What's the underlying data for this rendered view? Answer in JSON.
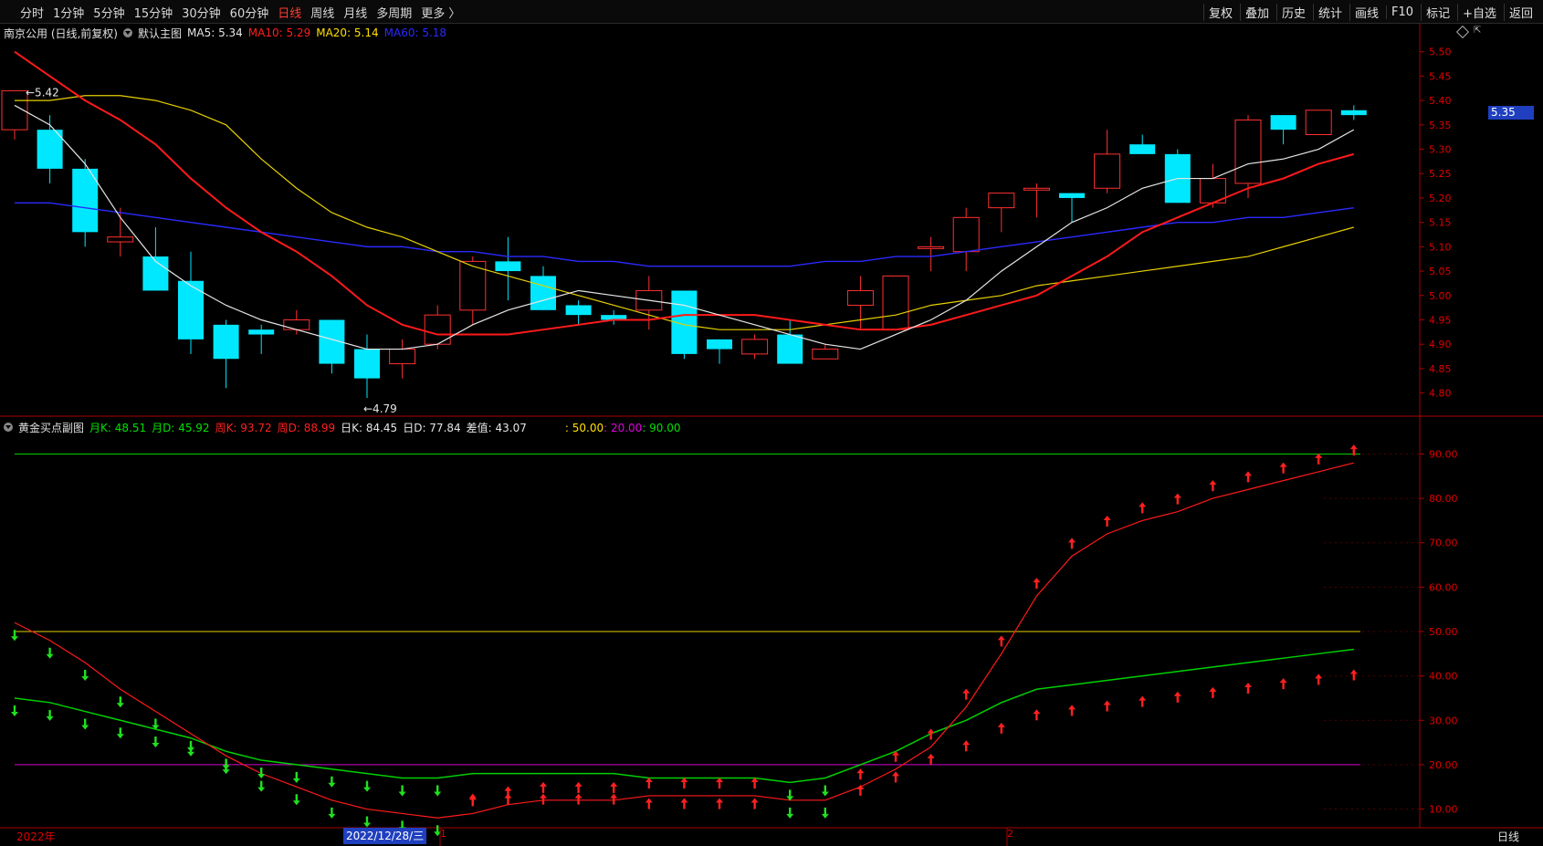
{
  "toolbar": {
    "periods": [
      "分时",
      "1分钟",
      "5分钟",
      "15分钟",
      "30分钟",
      "60分钟",
      "日线",
      "周线",
      "月线",
      "多周期",
      "更多 〉"
    ],
    "active_period": "日线",
    "tools": [
      "复权",
      "叠加",
      "历史",
      "统计",
      "画线",
      "F10",
      "标记",
      "+自选",
      "返回"
    ]
  },
  "main_chart": {
    "title": "南京公用 (日线,前复权)",
    "template": "默认主图",
    "ma": [
      {
        "label": "MA5: 5.34",
        "color": "#e6e6e6"
      },
      {
        "label": "MA10: 5.29",
        "color": "#ff2020"
      },
      {
        "label": "MA20: 5.14",
        "color": "#ffe000"
      },
      {
        "label": "MA60: 5.18",
        "color": "#2a2aff"
      }
    ],
    "current_price": "5.35",
    "high_label": "5.42",
    "low_label": "4.79",
    "y_ticks": [
      "5.50",
      "5.45",
      "5.40",
      "5.35",
      "5.30",
      "5.25",
      "5.20",
      "5.15",
      "5.10",
      "5.05",
      "5.00",
      "4.95",
      "4.90",
      "4.85",
      "4.80"
    ]
  },
  "sub_chart": {
    "title": "黄金买点副图",
    "values": [
      {
        "label": "月K: 48.51",
        "color": "#00e000"
      },
      {
        "label": "月D: 45.92",
        "color": "#00e000"
      },
      {
        "label": "周K: 93.72",
        "color": "#ff2020"
      },
      {
        "label": "周D: 88.99",
        "color": "#ff2020"
      },
      {
        "label": "日K: 84.45",
        "color": "#e6e6e6"
      },
      {
        "label": "日D: 77.84",
        "color": "#e6e6e6"
      },
      {
        "label": "差值: 43.07",
        "color": "#e6e6e6"
      }
    ],
    "levels": [
      {
        "label": ": 50.00",
        "color": "#ffe000"
      },
      {
        "label": ": 20.00",
        "color": "#e000e0"
      },
      {
        "label": ": 90.00",
        "color": "#00e000"
      }
    ],
    "y_ticks": [
      "90.00",
      "80.00",
      "70.00",
      "60.00",
      "50.00",
      "40.00",
      "30.00",
      "20.00",
      "10.00"
    ]
  },
  "x_axis": {
    "year_label": "2022年",
    "cursor_date": "2022/12/28/三",
    "month_marks": [
      "1",
      "2"
    ],
    "period_label": "日线"
  },
  "chart_data": {
    "type": "candlestick",
    "price_range": [
      4.76,
      5.52
    ],
    "candles": [
      {
        "o": 5.34,
        "h": 5.42,
        "l": 5.32,
        "c": 5.42
      },
      {
        "o": 5.34,
        "h": 5.37,
        "l": 5.23,
        "c": 5.26
      },
      {
        "o": 5.26,
        "h": 5.28,
        "l": 5.1,
        "c": 5.13
      },
      {
        "o": 5.11,
        "h": 5.18,
        "l": 5.08,
        "c": 5.12
      },
      {
        "o": 5.08,
        "h": 5.14,
        "l": 5.01,
        "c": 5.01
      },
      {
        "o": 5.03,
        "h": 5.09,
        "l": 4.88,
        "c": 4.91
      },
      {
        "o": 4.94,
        "h": 4.95,
        "l": 4.81,
        "c": 4.87
      },
      {
        "o": 4.93,
        "h": 4.94,
        "l": 4.88,
        "c": 4.92
      },
      {
        "o": 4.93,
        "h": 4.97,
        "l": 4.92,
        "c": 4.95
      },
      {
        "o": 4.95,
        "h": 4.95,
        "l": 4.84,
        "c": 4.86
      },
      {
        "o": 4.89,
        "h": 4.92,
        "l": 4.79,
        "c": 4.83
      },
      {
        "o": 4.86,
        "h": 4.91,
        "l": 4.83,
        "c": 4.89
      },
      {
        "o": 4.9,
        "h": 4.98,
        "l": 4.89,
        "c": 4.96
      },
      {
        "o": 4.97,
        "h": 5.08,
        "l": 4.94,
        "c": 5.07
      },
      {
        "o": 5.07,
        "h": 5.12,
        "l": 4.99,
        "c": 5.05
      },
      {
        "o": 5.04,
        "h": 5.06,
        "l": 4.97,
        "c": 4.97
      },
      {
        "o": 4.98,
        "h": 4.99,
        "l": 4.94,
        "c": 4.96
      },
      {
        "o": 4.96,
        "h": 4.97,
        "l": 4.94,
        "c": 4.95
      },
      {
        "o": 4.97,
        "h": 5.04,
        "l": 4.93,
        "c": 5.01
      },
      {
        "o": 5.01,
        "h": 5.01,
        "l": 4.87,
        "c": 4.88
      },
      {
        "o": 4.91,
        "h": 4.91,
        "l": 4.86,
        "c": 4.89
      },
      {
        "o": 4.88,
        "h": 4.92,
        "l": 4.87,
        "c": 4.91
      },
      {
        "o": 4.92,
        "h": 4.95,
        "l": 4.86,
        "c": 4.86
      },
      {
        "o": 4.87,
        "h": 4.9,
        "l": 4.87,
        "c": 4.89
      },
      {
        "o": 4.98,
        "h": 5.04,
        "l": 4.93,
        "c": 5.01
      },
      {
        "o": 4.93,
        "h": 5.04,
        "l": 4.93,
        "c": 5.04
      },
      {
        "o": 5.1,
        "h": 5.12,
        "l": 5.05,
        "c": 5.1
      },
      {
        "o": 5.09,
        "h": 5.18,
        "l": 5.05,
        "c": 5.16
      },
      {
        "o": 5.18,
        "h": 5.21,
        "l": 5.13,
        "c": 5.21
      },
      {
        "o": 5.22,
        "h": 5.23,
        "l": 5.16,
        "c": 5.22
      },
      {
        "o": 5.21,
        "h": 5.21,
        "l": 5.15,
        "c": 5.2
      },
      {
        "o": 5.22,
        "h": 5.34,
        "l": 5.21,
        "c": 5.29
      },
      {
        "o": 5.31,
        "h": 5.33,
        "l": 5.29,
        "c": 5.29
      },
      {
        "o": 5.29,
        "h": 5.3,
        "l": 5.19,
        "c": 5.19
      },
      {
        "o": 5.19,
        "h": 5.27,
        "l": 5.18,
        "c": 5.24
      },
      {
        "o": 5.23,
        "h": 5.37,
        "l": 5.2,
        "c": 5.36
      },
      {
        "o": 5.37,
        "h": 5.37,
        "l": 5.31,
        "c": 5.34
      },
      {
        "o": 5.33,
        "h": 5.38,
        "l": 5.33,
        "c": 5.38
      },
      {
        "o": 5.38,
        "h": 5.39,
        "l": 5.36,
        "c": 5.37
      }
    ],
    "ma5": [
      5.39,
      5.35,
      5.27,
      5.16,
      5.07,
      5.02,
      4.98,
      4.95,
      4.93,
      4.91,
      4.89,
      4.89,
      4.9,
      4.94,
      4.97,
      4.99,
      5.01,
      5.0,
      4.99,
      4.98,
      4.96,
      4.94,
      4.92,
      4.9,
      4.89,
      4.92,
      4.95,
      4.99,
      5.05,
      5.1,
      5.15,
      5.18,
      5.22,
      5.24,
      5.24,
      5.27,
      5.28,
      5.3,
      5.34
    ],
    "ma10": [
      5.5,
      5.45,
      5.4,
      5.36,
      5.31,
      5.24,
      5.18,
      5.13,
      5.09,
      5.04,
      4.98,
      4.94,
      4.92,
      4.92,
      4.92,
      4.93,
      4.94,
      4.95,
      4.95,
      4.96,
      4.96,
      4.96,
      4.95,
      4.94,
      4.93,
      4.93,
      4.94,
      4.96,
      4.98,
      5.0,
      5.04,
      5.08,
      5.13,
      5.16,
      5.19,
      5.22,
      5.24,
      5.27,
      5.29
    ],
    "ma20": [
      5.4,
      5.4,
      5.41,
      5.41,
      5.4,
      5.38,
      5.35,
      5.28,
      5.22,
      5.17,
      5.14,
      5.12,
      5.09,
      5.06,
      5.04,
      5.02,
      5.0,
      4.98,
      4.96,
      4.94,
      4.93,
      4.93,
      4.93,
      4.94,
      4.95,
      4.96,
      4.98,
      4.99,
      5.0,
      5.02,
      5.03,
      5.04,
      5.05,
      5.06,
      5.07,
      5.08,
      5.1,
      5.12,
      5.14
    ],
    "ma60": [
      5.19,
      5.19,
      5.18,
      5.17,
      5.16,
      5.15,
      5.14,
      5.13,
      5.12,
      5.11,
      5.1,
      5.1,
      5.09,
      5.09,
      5.08,
      5.08,
      5.07,
      5.07,
      5.06,
      5.06,
      5.06,
      5.06,
      5.06,
      5.07,
      5.07,
      5.08,
      5.08,
      5.09,
      5.1,
      5.11,
      5.12,
      5.13,
      5.14,
      5.15,
      5.15,
      5.16,
      5.16,
      5.17,
      5.18
    ],
    "sub_range": [
      6,
      94
    ],
    "month_k": [
      35,
      34,
      32,
      30,
      28,
      26,
      23,
      21,
      20,
      19,
      18,
      17,
      17,
      18,
      18,
      18,
      18,
      18,
      17,
      17,
      17,
      17,
      16,
      17,
      20,
      23,
      27,
      30,
      34,
      37,
      38,
      39,
      40,
      41,
      42,
      43,
      44,
      45,
      46
    ],
    "week_k": [
      52,
      48,
      43,
      37,
      32,
      27,
      22,
      18,
      15,
      12,
      10,
      9,
      8,
      9,
      11,
      12,
      12,
      12,
      13,
      13,
      13,
      13,
      12,
      12,
      15,
      19,
      24,
      33,
      45,
      58,
      67,
      72,
      75,
      77,
      80,
      82,
      84,
      86,
      88
    ],
    "signals_week": [
      "down",
      "down",
      "down",
      "down",
      "down",
      "down",
      "down",
      "down",
      "down",
      "down",
      "down",
      "down",
      "down",
      "up",
      "up",
      "up",
      "up",
      "up",
      "up",
      "up",
      "up",
      "up",
      "down",
      "down",
      "up",
      "up",
      "up",
      "up",
      "up",
      "up",
      "up",
      "up",
      "up",
      "up",
      "up",
      "up",
      "up",
      "up",
      "up"
    ]
  }
}
